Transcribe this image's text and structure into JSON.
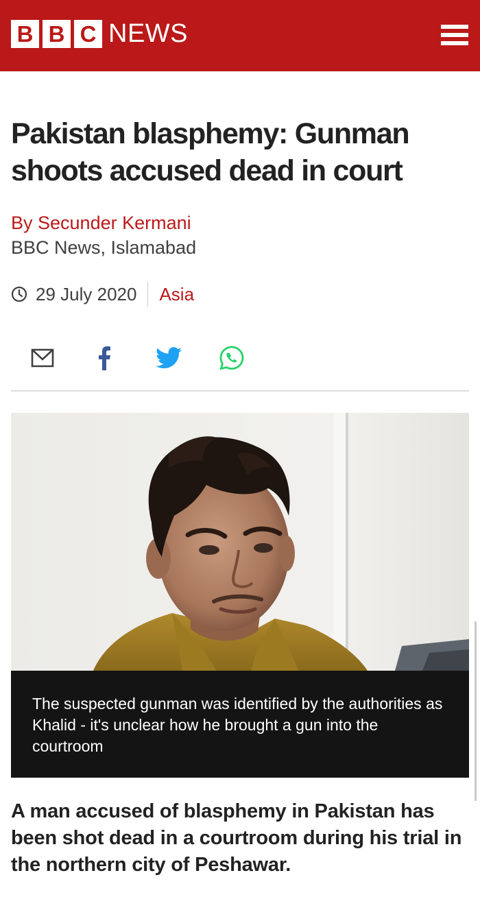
{
  "brand": {
    "letters": [
      "B",
      "B",
      "C"
    ],
    "name": "NEWS",
    "color": "#bb1919"
  },
  "header": {
    "menu_icon": "hamburger-menu-icon"
  },
  "article": {
    "headline": "Pakistan blasphemy: Gunman shoots accused dead in court",
    "byline": {
      "author": "By Secunder Kermani",
      "location": "BBC News, Islamabad"
    },
    "date": "29 July 2020",
    "date_icon": "clock-icon",
    "section": "Asia",
    "share": [
      {
        "name": "email",
        "icon": "email-icon"
      },
      {
        "name": "facebook",
        "icon": "facebook-icon"
      },
      {
        "name": "twitter",
        "icon": "twitter-icon"
      },
      {
        "name": "whatsapp",
        "icon": "whatsapp-icon"
      }
    ],
    "image": {
      "caption": "The suspected gunman was identified by the authorities as Khalid - it's unclear how he brought a gun into the courtroom"
    },
    "intro": "A man accused of blasphemy in Pakistan has been shot dead in a courtroom during his trial in the northern city of Peshawar."
  }
}
